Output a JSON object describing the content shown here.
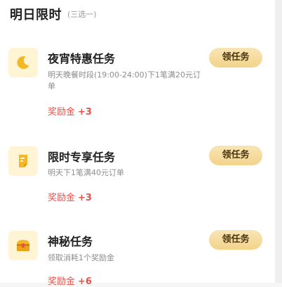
{
  "section": {
    "title": "明日限时",
    "subtitle": "(三选一)"
  },
  "tasks": [
    {
      "icon": "moon-icon",
      "title": "夜宵特惠任务",
      "description": "明天晚餐时段(19:00-24:00)下1笔满20元订单",
      "reward_label": "奖励金",
      "reward_amount": "+3",
      "button_label": "领任务"
    },
    {
      "icon": "coupon-icon",
      "title": "限时专享任务",
      "description": "明天下1笔满40元订单",
      "reward_label": "奖励金",
      "reward_amount": "+3",
      "button_label": "领任务"
    },
    {
      "icon": "treasure-chest-icon",
      "title": "神秘任务",
      "description": "领取消耗1个奖励金",
      "reward_label": "奖励金",
      "reward_amount": "+6",
      "button_label": "领任务"
    }
  ],
  "colors": {
    "reward": "#e9524a",
    "button_gradient_top": "#f9e5b4",
    "button_gradient_bottom": "#f2d38a",
    "icon_background": "#fff4d3",
    "icon_gold": "#f5b623"
  }
}
